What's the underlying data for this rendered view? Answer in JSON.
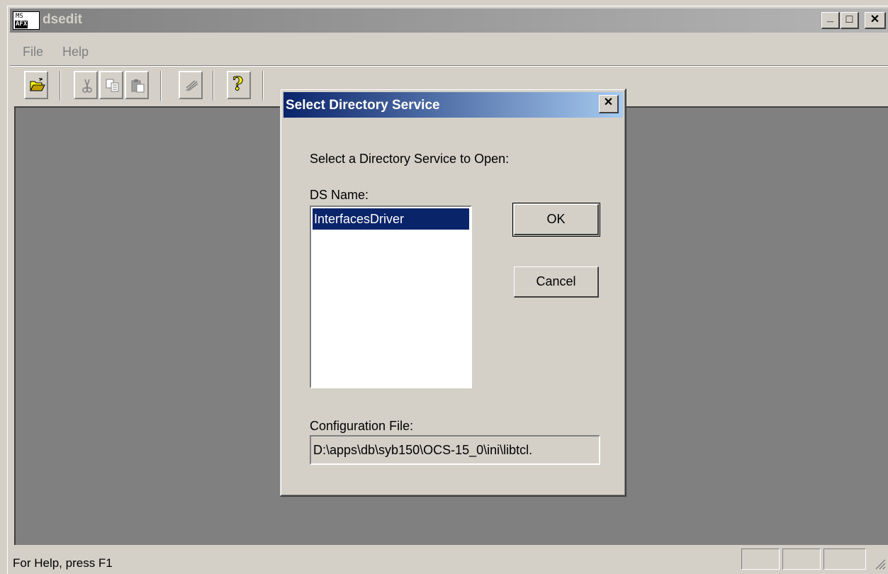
{
  "window": {
    "title": "dsedit",
    "icon_top": "MS",
    "icon_bottom": "AFX",
    "controls": {
      "minimize": "_",
      "maximize": "□",
      "close": "✕"
    }
  },
  "menu": {
    "items": [
      "File",
      "Help"
    ]
  },
  "toolbar": {
    "buttons": [
      "open-folder-icon",
      "cut-icon",
      "copy-icon",
      "paste-icon",
      "modify-icon",
      "help-icon"
    ],
    "help_glyph": "?"
  },
  "status": {
    "text": "For Help, press F1"
  },
  "dialog": {
    "title": "Select Directory Service",
    "close": "✕",
    "prompt": "Select a Directory Service to Open:",
    "ds_label": "DS Name:",
    "ds_items": [
      "InterfacesDriver"
    ],
    "ok_label": "OK",
    "cancel_label": "Cancel",
    "config_label": "Configuration File:",
    "config_value": "D:\\apps\\db\\syb150\\OCS-15_0\\ini\\libtcl."
  },
  "colors": {
    "face": "#d4d0c8",
    "workspace": "#808080",
    "active_title_start": "#0a246a",
    "active_title_end": "#a6caf0",
    "selection": "#0a246a"
  }
}
